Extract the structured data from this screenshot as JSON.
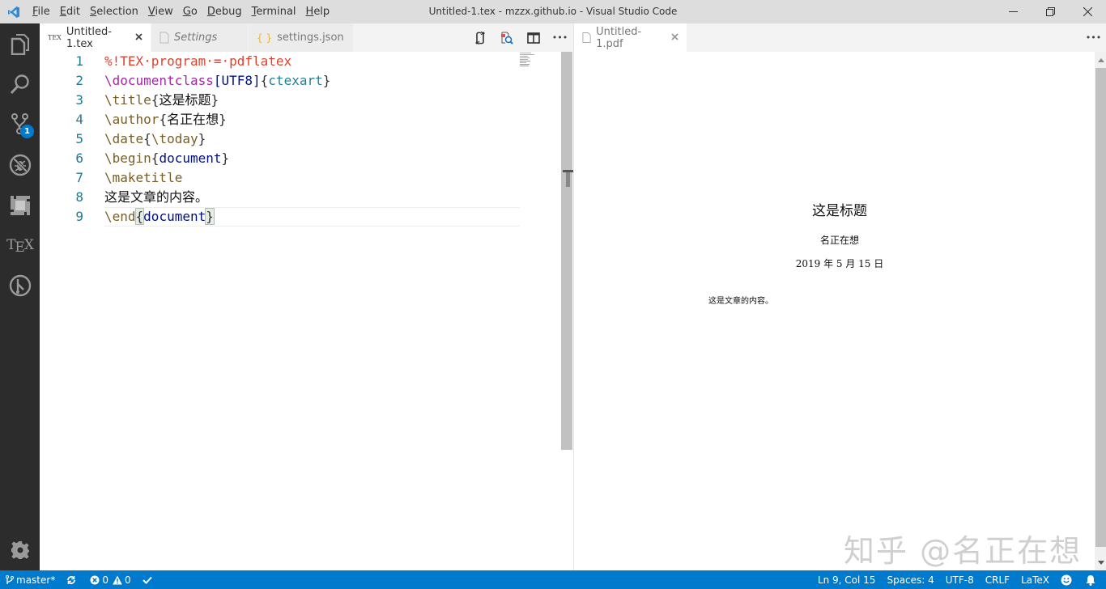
{
  "titlebar": {
    "app_icon": "vscode-logo-icon",
    "menu": [
      "File",
      "Edit",
      "Selection",
      "View",
      "Go",
      "Debug",
      "Terminal",
      "Help"
    ],
    "menu_mnemonic": [
      "F",
      "E",
      "S",
      "V",
      "G",
      "D",
      "T",
      "H"
    ],
    "window_title": "Untitled-1.tex - mzzx.github.io - Visual Studio Code",
    "controls": [
      "minimize-icon",
      "restore-icon",
      "close-icon"
    ]
  },
  "activitybar": {
    "items": [
      {
        "name": "explorer",
        "icon": "files-icon"
      },
      {
        "name": "search",
        "icon": "search-icon"
      },
      {
        "name": "source-control",
        "icon": "git-branch-icon",
        "badge": "1"
      },
      {
        "name": "debug",
        "icon": "no-bug-icon"
      },
      {
        "name": "extensions",
        "icon": "extensions-icon"
      },
      {
        "name": "tex",
        "icon": "tex-icon",
        "label": "TEX"
      },
      {
        "name": "gitlens",
        "icon": "git-history-icon"
      }
    ],
    "settings_icon": "gear-icon"
  },
  "editor_left": {
    "tabs": [
      {
        "label": "Untitled-1.tex",
        "icon": "tex-file-icon",
        "icon_text": "TEX",
        "active": true,
        "closable": true
      },
      {
        "label": "Settings",
        "icon": "file-icon",
        "active": false,
        "italic": true
      },
      {
        "label": "settings.json",
        "icon": "json-braces-icon",
        "icon_text": "{ }",
        "active": false
      }
    ],
    "actions": [
      "open-changes-icon",
      "pdf-preview-icon",
      "split-editor-icon",
      "more-actions-icon"
    ],
    "more_label": "•••",
    "lines": [
      {
        "no": "1",
        "tokens": [
          {
            "t": "%!TEX·program·=·pdflatex",
            "c": "c-comment"
          }
        ]
      },
      {
        "no": "2",
        "tokens": [
          {
            "t": "\\documentclass",
            "c": "c-cmd-purple"
          },
          {
            "t": "[UTF8]",
            "c": "c-arg"
          },
          {
            "t": "{",
            "c": "c-brace"
          },
          {
            "t": "ctexart",
            "c": "c-teal"
          },
          {
            "t": "}",
            "c": "c-brace"
          }
        ]
      },
      {
        "no": "3",
        "tokens": [
          {
            "t": "\\title",
            "c": "c-cmd"
          },
          {
            "t": "{",
            "c": "c-brace"
          },
          {
            "t": "这是标题",
            "c": "c-text"
          },
          {
            "t": "}",
            "c": "c-brace"
          }
        ]
      },
      {
        "no": "4",
        "tokens": [
          {
            "t": "\\author",
            "c": "c-cmd"
          },
          {
            "t": "{",
            "c": "c-brace"
          },
          {
            "t": "名正在想",
            "c": "c-text"
          },
          {
            "t": "}",
            "c": "c-brace"
          }
        ]
      },
      {
        "no": "5",
        "tokens": [
          {
            "t": "\\date",
            "c": "c-cmd"
          },
          {
            "t": "{",
            "c": "c-brace"
          },
          {
            "t": "\\today",
            "c": "c-cmd"
          },
          {
            "t": "}",
            "c": "c-brace"
          }
        ]
      },
      {
        "no": "6",
        "tokens": [
          {
            "t": "\\begin",
            "c": "c-cmd"
          },
          {
            "t": "{",
            "c": "c-brace"
          },
          {
            "t": "document",
            "c": "c-arg"
          },
          {
            "t": "}",
            "c": "c-brace"
          }
        ]
      },
      {
        "no": "7",
        "tokens": [
          {
            "t": "\\maketitle",
            "c": "c-cmd"
          }
        ]
      },
      {
        "no": "8",
        "tokens": [
          {
            "t": "这是文章的内容。",
            "c": "c-text"
          }
        ]
      },
      {
        "no": "9",
        "tokens": [
          {
            "t": "\\end",
            "c": "c-cmd"
          },
          {
            "t": "{",
            "c": "c-brace bracket-match"
          },
          {
            "t": "document",
            "c": "c-arg"
          },
          {
            "t": "}",
            "c": "c-brace bracket-match"
          }
        ]
      }
    ],
    "current_line": 9
  },
  "editor_right": {
    "tab": {
      "label": "Untitled-1.pdf",
      "icon": "file-icon",
      "closable": true
    },
    "more_label": "•••",
    "pdf": {
      "title": "这是标题",
      "author": "名正在想",
      "date": "2019 年 5 月 15 日",
      "body": "这是文章的内容。"
    },
    "watermark": "知乎 @名正在想"
  },
  "statusbar": {
    "branch": "master*",
    "sync_icon": "sync-icon",
    "errors": "0",
    "warnings": "0",
    "check_icon": "check-icon",
    "position": "Ln 9, Col 15",
    "indent": "Spaces: 4",
    "encoding": "UTF-8",
    "eol": "CRLF",
    "language": "LaTeX",
    "feedback_icon": "smiley-icon",
    "notifications_icon": "bell-icon"
  },
  "colors": {
    "statusbar_bg": "#007acc",
    "activitybar_bg": "#2c2c2c",
    "titlebar_bg": "#dddddd",
    "badge_bg": "#007acc",
    "comment": "#e0412c",
    "line_number": "#237893"
  }
}
